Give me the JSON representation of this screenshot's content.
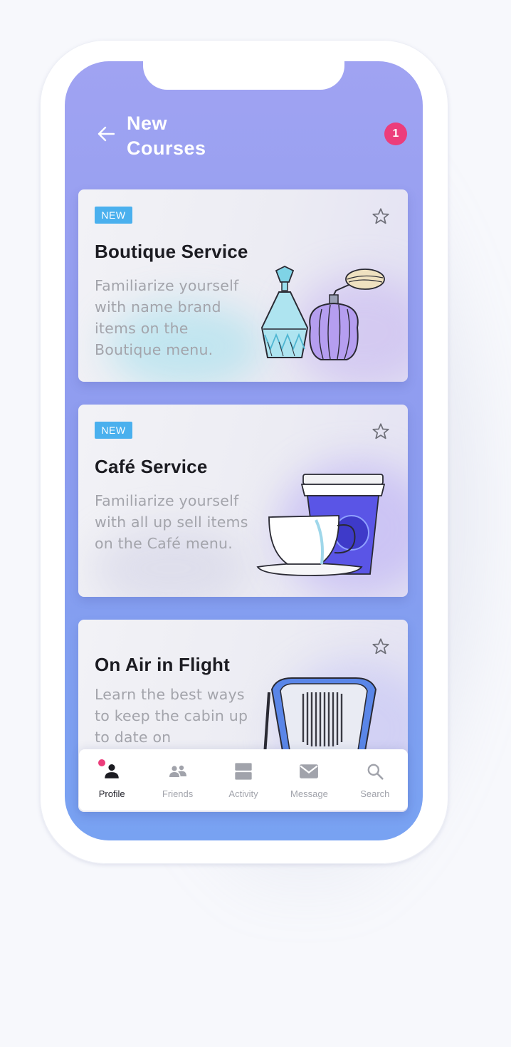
{
  "header": {
    "title": "New Courses",
    "notification_count": "1"
  },
  "courses": [
    {
      "badge": "NEW",
      "title": "Boutique Service",
      "description": "Familiarize yourself with name brand items on the Boutique menu."
    },
    {
      "badge": "NEW",
      "title": "Café Service",
      "description": "Familiarize yourself with all up sell items on the Café menu."
    },
    {
      "title": "On Air in Flight",
      "description": "Learn the best ways to keep the cabin up to date on"
    }
  ],
  "tabbar": {
    "items": [
      {
        "label": "Profile",
        "icon": "profile-icon",
        "active": true
      },
      {
        "label": "Friends",
        "icon": "friends-icon"
      },
      {
        "label": "Activity",
        "icon": "activity-icon"
      },
      {
        "label": "Message",
        "icon": "message-icon"
      },
      {
        "label": "Search",
        "icon": "search-icon"
      }
    ]
  },
  "colors": {
    "accent_pink": "#ec3d7b",
    "badge_blue": "#4ab0ee",
    "screen_gradient_top": "#a0a3f2",
    "screen_gradient_bottom": "#78a2f2"
  }
}
